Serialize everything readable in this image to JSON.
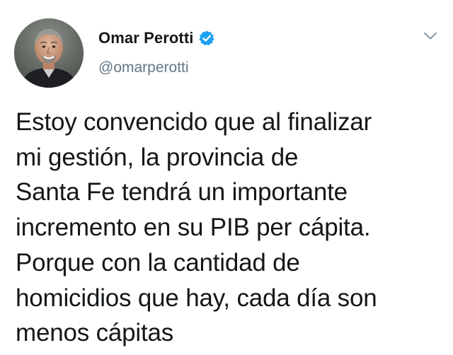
{
  "tweet": {
    "author": {
      "display_name": "Omar Perotti",
      "handle": "@omarperotti",
      "verified": true,
      "avatar_icon": "profile-photo"
    },
    "menu_icon": "chevron-down-icon",
    "text_lines": [
      "Estoy convencido que al finalizar",
      "mi gestión, la provincia de",
      "Santa Fe tendrá un importante",
      "incremento en su PIB per cápita.",
      "Porque con la cantidad de",
      "homicidios que hay, cada día son",
      "menos cápitas"
    ]
  },
  "colors": {
    "verified_blue": "#1da1f2",
    "text": "#14171a",
    "secondary_text": "#657786",
    "caret": "#8899a6"
  }
}
